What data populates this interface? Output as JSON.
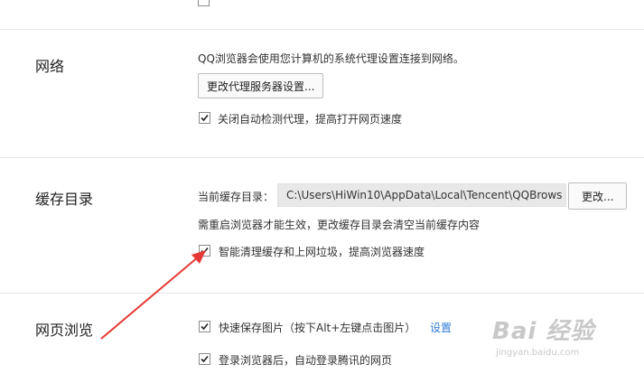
{
  "network": {
    "title": "网络",
    "description": "QQ浏览器会使用您计算机的系统代理设置连接到网络。",
    "proxy_button": "更改代理服务器设置...",
    "auto_detect_label": "关闭自动检测代理，提高打开网页速度",
    "auto_detect_checked": true
  },
  "cache": {
    "title": "缓存目录",
    "current_label": "当前缓存目录：",
    "path": "C:\\Users\\HiWin10\\AppData\\Local\\Tencent\\QQBrows",
    "change_button": "更改...",
    "notice": "需重启浏览器才能生效，更改缓存目录会清空当前缓存内容",
    "smart_clean_label": "智能清理缓存和上网垃圾，提高浏览器速度",
    "smart_clean_checked": true
  },
  "browsing": {
    "title": "网页浏览",
    "quick_save_label": "快速保存图片（按下Alt+左键点击图片）",
    "quick_save_checked": true,
    "settings_link": "设置",
    "auto_login_label": "登录浏览器后，自动登录腾讯的网页",
    "auto_login_checked": true
  },
  "watermark": {
    "brand": "Bai 经验",
    "url": "jingyan.baidu.com"
  },
  "colors": {
    "link": "#2f7ad6",
    "annotation_arrow": "#e53935",
    "divider": "#e4e4e4"
  }
}
